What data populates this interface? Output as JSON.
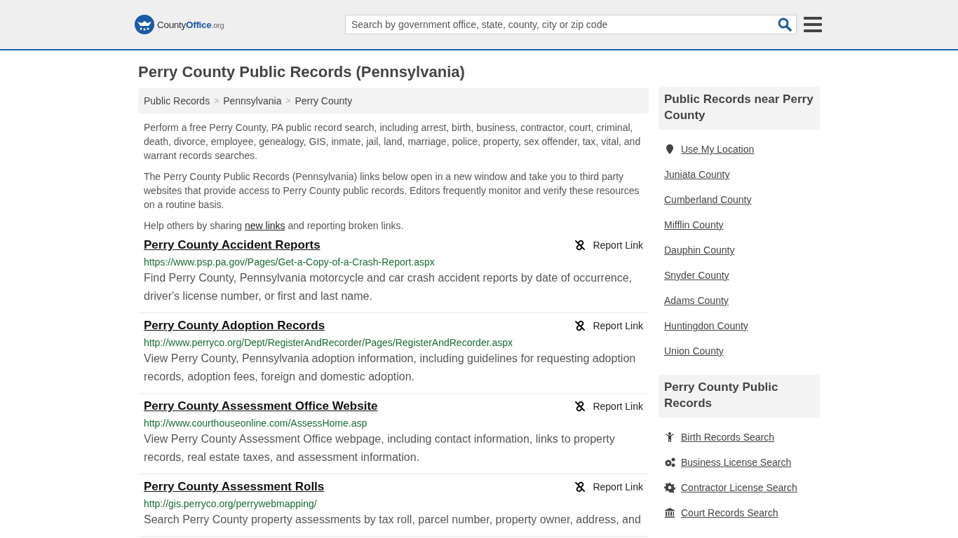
{
  "header": {
    "logo": [
      "County",
      "Office",
      ".org"
    ],
    "search": {
      "placeholder": "Search by government office, state, county, city or zip code"
    }
  },
  "title": "Perry County Public Records (Pennsylvania)",
  "breadcrumbs": [
    "Public Records",
    "Pennsylvania",
    "Perry County"
  ],
  "breadcrumb_separator": ">",
  "intro": [
    "Perform a free Perry County, PA public record search, including arrest, birth, business, contractor, court, criminal, death, divorce, employee, genealogy, GIS, inmate, jail, land, marriage, police, property, sex offender, tax, vital, and warrant records searches.",
    "The Perry County Public Records (Pennsylvania) links below open in a new window and take you to third party websites that provide access to Perry County public records. Editors frequently monitor and verify these resources on a routine basis."
  ],
  "help": {
    "before": "Help others by sharing",
    "link": "new links",
    "after": "and reporting broken links."
  },
  "records": [
    {
      "title": "Perry County Accident Reports",
      "url": "https://www.psp.pa.gov/Pages/Get-a-Copy-of-a-Crash-Report.aspx",
      "description": "Find Perry County, Pennsylvania motorcycle and car crash accident reports by date of occurrence, driver's license number, or first and last name.",
      "report": "Report Link"
    },
    {
      "title": "Perry County Adoption Records",
      "url": "http://www.perryco.org/Dept/RegisterAndRecorder/Pages/RegisterAndRecorder.aspx",
      "description": "View Perry County, Pennsylvania adoption information, including guidelines for requesting adoption records, adoption fees, foreign and domestic adoption.",
      "report": "Report Link"
    },
    {
      "title": "Perry County Assessment Office Website",
      "url": "http://www.courthouseonline.com/AssessHome.asp",
      "description": "View Perry County Assessment Office webpage, including contact information, links to property records, real estate taxes, and assessment information.",
      "report": "Report Link"
    },
    {
      "title": "Perry County Assessment Rolls",
      "url": "http://gis.perryco.org/perrywebmapping/",
      "description": "Search Perry County property assessments by tax roll, parcel number, property owner, address, and",
      "report": "Report Link"
    }
  ],
  "sidebar": [
    {
      "heading": "Public Records near Perry County",
      "links": [
        {
          "label": "Use My Location",
          "kind": "location"
        },
        {
          "label": "Juniata County",
          "kind": "plain"
        },
        {
          "label": "Cumberland County",
          "kind": "plain"
        },
        {
          "label": "Mifflin County",
          "kind": "plain"
        },
        {
          "label": "Dauphin County",
          "kind": "plain"
        },
        {
          "label": "Snyder County",
          "kind": "plain"
        },
        {
          "label": "Adams County",
          "kind": "plain"
        },
        {
          "label": "Huntingdon County",
          "kind": "plain"
        },
        {
          "label": "Union County",
          "kind": "plain"
        }
      ]
    },
    {
      "heading": "Perry County Public Records",
      "links": [
        {
          "label": "Birth Records Search",
          "kind": "child"
        },
        {
          "label": "Business License Search",
          "kind": "gears"
        },
        {
          "label": "Contractor License Search",
          "kind": "gear"
        },
        {
          "label": "Court Records Search",
          "kind": "courthouse"
        }
      ]
    }
  ]
}
